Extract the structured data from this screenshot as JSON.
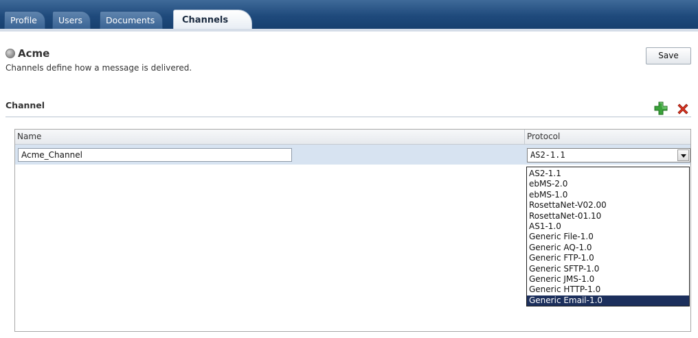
{
  "tabs": [
    {
      "label": "Profile",
      "active": false
    },
    {
      "label": "Users",
      "active": false
    },
    {
      "label": "Documents",
      "active": false
    },
    {
      "label": "Channels",
      "active": true
    }
  ],
  "header": {
    "title": "Acme",
    "subtitle": "Channels define how a message is delivered.",
    "save_label": "Save",
    "title_icon": "globe-icon"
  },
  "section": {
    "title": "Channel",
    "add_icon": "add-icon",
    "delete_icon": "delete-icon"
  },
  "table": {
    "columns": [
      "Name",
      "Protocol"
    ],
    "rows": [
      {
        "name": "Acme_Channel",
        "protocol": "AS2-1.1"
      }
    ]
  },
  "protocol_dropdown": {
    "options": [
      "AS2-1.1",
      "ebMS-2.0",
      "ebMS-1.0",
      "RosettaNet-V02.00",
      "RosettaNet-01.10",
      "AS1-1.0",
      "Generic File-1.0",
      "Generic AQ-1.0",
      "Generic FTP-1.0",
      "Generic SFTP-1.0",
      "Generic JMS-1.0",
      "Generic HTTP-1.0",
      "Generic Email-1.0"
    ],
    "highlighted": "Generic Email-1.0"
  },
  "colors": {
    "tabbar": "#1f4a7c",
    "row_selected": "#d7e3f1",
    "dropdown_highlight": "#1c2f5c",
    "add_icon": "#2e9a2e",
    "delete_icon": "#d42a1a"
  }
}
